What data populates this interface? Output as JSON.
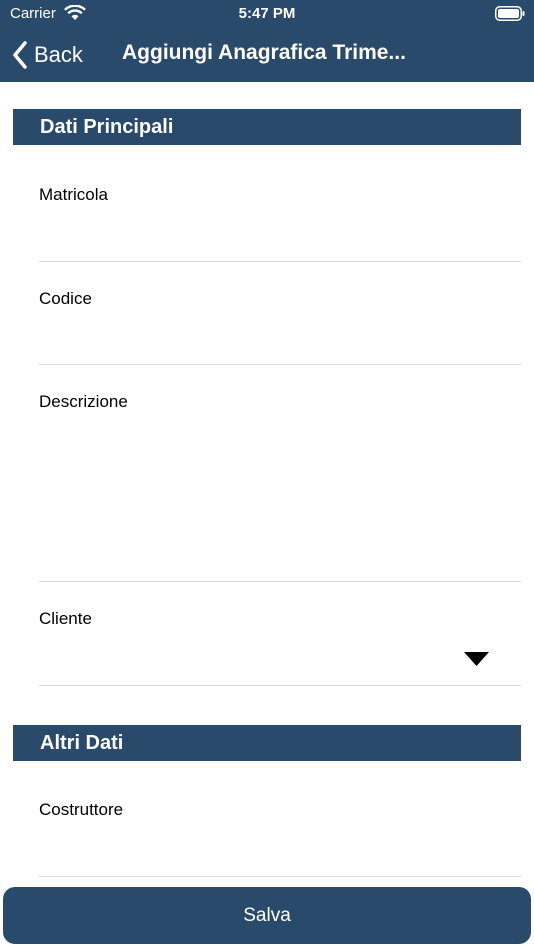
{
  "status_bar": {
    "carrier": "Carrier",
    "time": "5:47 PM"
  },
  "nav": {
    "back_label": "Back",
    "title": "Aggiungi Anagrafica Trime..."
  },
  "sections": {
    "main": {
      "title": "Dati Principali",
      "fields": {
        "matricola": {
          "label": "Matricola",
          "value": ""
        },
        "codice": {
          "label": "Codice",
          "value": ""
        },
        "descrizione": {
          "label": "Descrizione",
          "value": ""
        },
        "cliente": {
          "label": "Cliente",
          "value": ""
        }
      }
    },
    "other": {
      "title": "Altri Dati",
      "fields": {
        "costruttore": {
          "label": "Costruttore",
          "value": ""
        }
      }
    }
  },
  "save_label": "Salva",
  "colors": {
    "brand": "#2a4a6c",
    "divider": "#d9d9d9"
  }
}
